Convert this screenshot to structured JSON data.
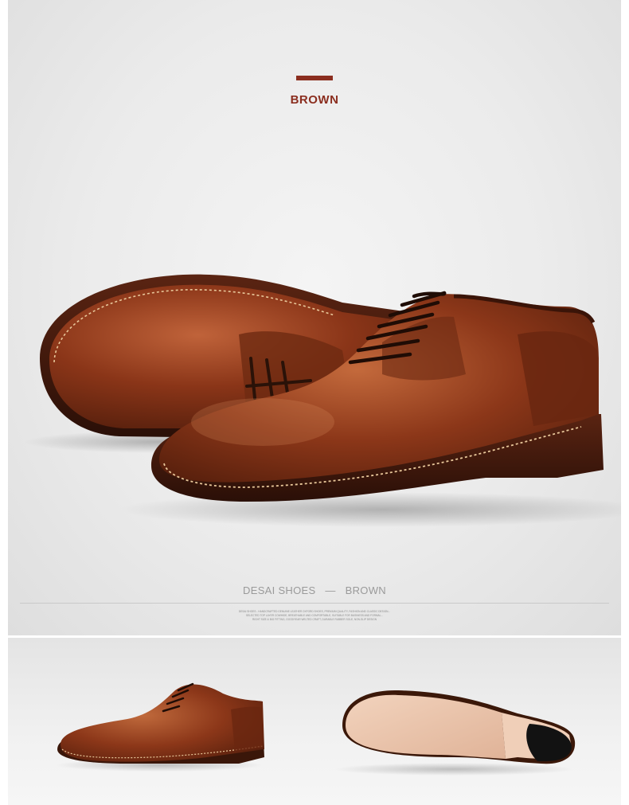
{
  "hero": {
    "color_label": "BROWN",
    "caption_brand": "DESAI SHOES",
    "caption_dash": "—",
    "caption_color": "BROWN",
    "fine_print": [
      "DESAI SHOES - HANDCRAFTED GENUINE LEATHER OXFORD SHOES, PREMIUM QUALITY, FASHION AND CLASSIC DESIGN...",
      "SELECTED TOP LAYER COWHIDE, BREATHABLE AND COMFORTABLE, SUITABLE FOR BUSINESS AND FORMAL...",
      "RIGHT SIZE & BIG FITTING, GOODYEAR WELTED CRAFT, DURABLE RUBBER SOLE, NON-SLIP DESIGN"
    ]
  },
  "colors": {
    "accent": "#8b2e1f",
    "leather": "#7a2e16",
    "sole": "#e8c2a8"
  }
}
